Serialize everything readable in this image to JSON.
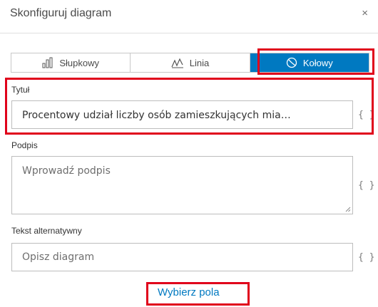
{
  "dialog": {
    "title": "Skonfiguruj diagram",
    "close_glyph": "×"
  },
  "tabs": [
    {
      "label": "Słupkowy",
      "icon": "bar-chart-icon",
      "active": false
    },
    {
      "label": "Linia",
      "icon": "line-chart-icon",
      "active": false
    },
    {
      "label": "Kołowy",
      "icon": "pie-chart-icon",
      "active": true
    }
  ],
  "fields": {
    "title": {
      "label": "Tytuł",
      "value": "Procentowy udział liczby osób zamieszkujących mia…"
    },
    "caption": {
      "label": "Podpis",
      "placeholder": "Wprowadź podpis"
    },
    "alt_text": {
      "label": "Tekst alternatywny",
      "placeholder": "Opisz diagram"
    },
    "expression_glyph": "{ }"
  },
  "actions": {
    "select_fields": "Wybierz pola"
  },
  "colors": {
    "accent": "#0079c1",
    "highlight": "#e0001b"
  }
}
